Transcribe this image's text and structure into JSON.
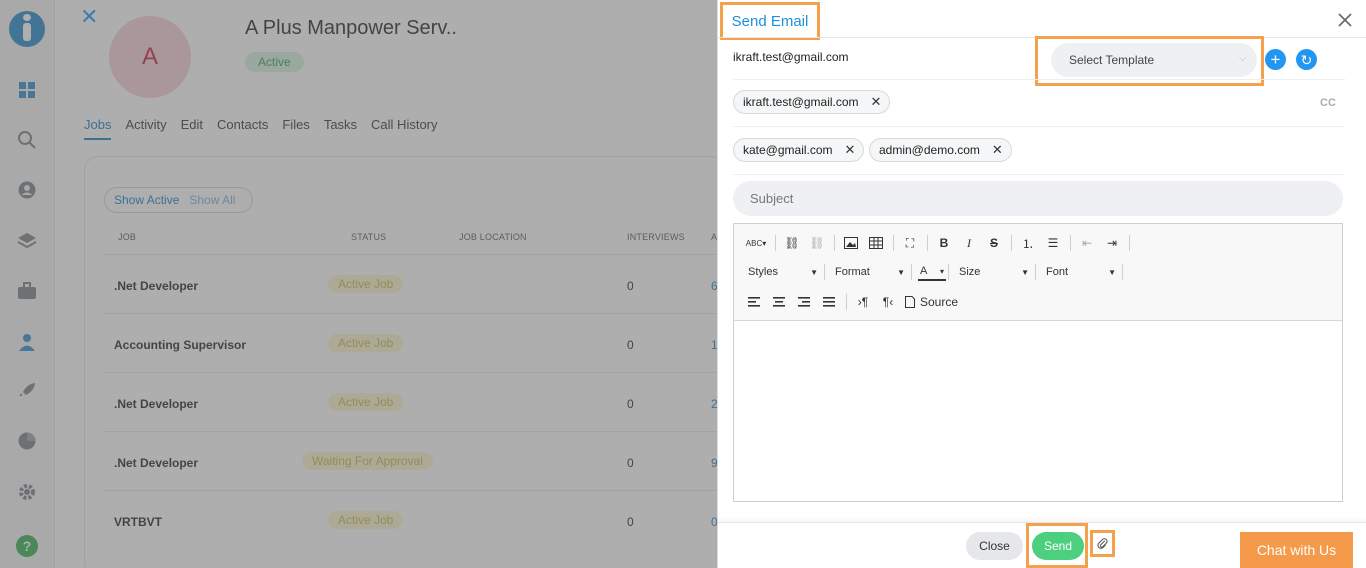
{
  "sidebar": {
    "icons": [
      "app-logo",
      "dashboard-icon",
      "search-icon",
      "user-icon",
      "layers-icon",
      "briefcase-icon",
      "contact-icon",
      "rocket-icon",
      "pie-chart-icon",
      "settings-icon",
      "help-icon"
    ],
    "help_label": "?"
  },
  "record": {
    "close_glyph": "✕",
    "avatar_letter": "A",
    "company_name": "A Plus Manpower Serv..",
    "status": "Active",
    "tabs": [
      "Jobs",
      "Activity",
      "Edit",
      "Contacts",
      "Files",
      "Tasks",
      "Call History"
    ],
    "active_tab": "Jobs",
    "toggle": {
      "show_active": "Show Active",
      "show_all": "Show All"
    },
    "columns": {
      "job": "JOB",
      "status": "STATUS",
      "location": "JOB LOCATION",
      "interviews": "INTERVIEWS",
      "applicants": "A"
    },
    "jobs": [
      {
        "title": ".Net Developer",
        "status": "Active Job",
        "interviews": "0",
        "applicants": "6"
      },
      {
        "title": "Accounting Supervisor",
        "status": "Active Job",
        "interviews": "0",
        "applicants": "1"
      },
      {
        "title": ".Net Developer",
        "status": "Active Job",
        "interviews": "0",
        "applicants": "2"
      },
      {
        "title": ".Net Developer",
        "status": "Waiting For Approval",
        "interviews": "0",
        "applicants": "9"
      },
      {
        "title": "VRTBVT",
        "status": "Active Job",
        "interviews": "0",
        "applicants": "0"
      }
    ]
  },
  "modal": {
    "title": "Send Email",
    "close_glyph": "✕",
    "from_email": "ikraft.test@gmail.com",
    "template_placeholder": "Select Template",
    "add_glyph": "+",
    "refresh_glyph": "↻",
    "to_chips": [
      "ikraft.test@gmail.com"
    ],
    "cc_label": "CC",
    "cc_chips": [
      "kate@gmail.com",
      "admin@demo.com"
    ],
    "chip_remove_glyph": "✕",
    "subject_placeholder": "Subject",
    "toolbar": {
      "styles": "Styles",
      "format": "Format",
      "size": "Size",
      "font": "Font",
      "source": "Source",
      "text_color": "A"
    },
    "close_label": "Close",
    "send_label": "Send"
  },
  "chat": {
    "label": "Chat with Us"
  },
  "colors": {
    "accent_blue": "#2196f3",
    "highlight_orange": "#f5a04a",
    "send_green": "#4ccf7e",
    "chat_orange": "#f5994a"
  }
}
